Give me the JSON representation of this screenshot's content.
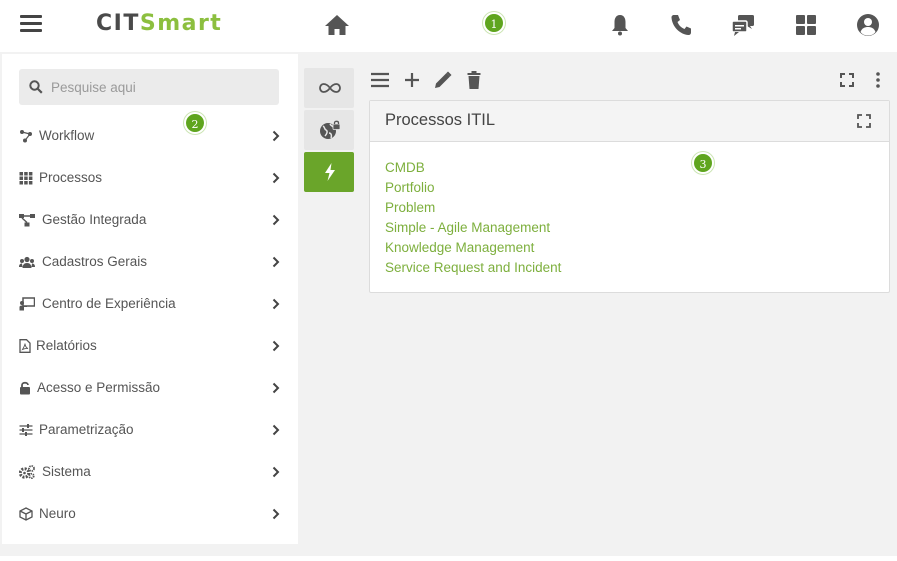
{
  "brand": {
    "part1": "CIT",
    "part2": "Smart",
    "accent": "#8cbf3f"
  },
  "badges": [
    "1",
    "2",
    "3"
  ],
  "header": {
    "icons": [
      "menu-icon",
      "home-icon",
      "bell-icon",
      "phone-icon",
      "chat-icon",
      "apps-grid-icon",
      "user-account-icon"
    ]
  },
  "search": {
    "placeholder": "Pesquise aqui",
    "value": ""
  },
  "sidebar": {
    "items": [
      {
        "label": "Workflow",
        "icon": "workflow-icon"
      },
      {
        "label": "Processos",
        "icon": "grid-icon"
      },
      {
        "label": "Gestão Integrada",
        "icon": "network-icon"
      },
      {
        "label": "Cadastros Gerais",
        "icon": "users-icon"
      },
      {
        "label": "Centro de Experiência",
        "icon": "presentation-icon"
      },
      {
        "label": "Relatórios",
        "icon": "pdf-file-icon"
      },
      {
        "label": "Acesso e Permissão",
        "icon": "lock-icon"
      },
      {
        "label": "Parametrização",
        "icon": "sliders-icon"
      },
      {
        "label": "Sistema",
        "icon": "gears-icon"
      },
      {
        "label": "Neuro",
        "icon": "cube-icon"
      }
    ]
  },
  "midcol": {
    "icons": [
      "infinity-icon",
      "globe-lock-icon",
      "lightning-icon"
    ],
    "active_index": 2,
    "active_color": "#6aa52a"
  },
  "toolbar": {
    "icons": [
      "list-icon",
      "plus-icon",
      "pencil-icon",
      "trash-icon",
      "fullscreen-icon",
      "more-vertical-icon"
    ]
  },
  "panel": {
    "title": "Processos ITIL",
    "links": [
      "CMDB",
      "Portfolio",
      "Problem",
      "Simple - Agile Management",
      "Knowledge Management",
      "Service Request and Incident"
    ],
    "link_color": "#7daf3d"
  }
}
